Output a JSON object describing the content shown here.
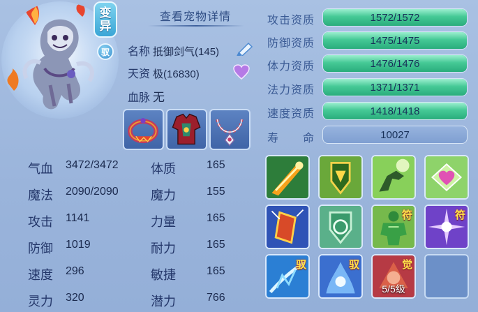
{
  "header": {
    "variant_badge": "变异",
    "variant_badge_top": "变",
    "variant_badge_bottom": "异",
    "tame_badge": "驭",
    "detail_title": "查看宠物详情"
  },
  "info": {
    "name_label": "名称",
    "name_value": "抵御剑气(145)",
    "talent_label": "天资",
    "talent_value": "极(16830)",
    "bloodline_label": "血脉",
    "bloodline_value": "无"
  },
  "equipment": [
    {
      "icon": "collar-icon"
    },
    {
      "icon": "armor-icon"
    },
    {
      "icon": "necklace-icon"
    }
  ],
  "stats": [
    {
      "label": "气血",
      "value": "3472/3472",
      "label2": "体质",
      "value2": "165"
    },
    {
      "label": "魔法",
      "value": "2090/2090",
      "label2": "魔力",
      "value2": "155"
    },
    {
      "label": "攻击",
      "value": "1141",
      "label2": "力量",
      "value2": "165"
    },
    {
      "label": "防御",
      "value": "1019",
      "label2": "耐力",
      "value2": "165"
    },
    {
      "label": "速度",
      "value": "296",
      "label2": "敏捷",
      "value2": "165"
    },
    {
      "label": "灵力",
      "value": "320",
      "label2": "潜力",
      "value2": "766"
    }
  ],
  "aptitudes": [
    {
      "label": "攻击资质",
      "text": "1572/1572",
      "current": 1572,
      "max": 1572
    },
    {
      "label": "防御资质",
      "text": "1475/1475",
      "current": 1475,
      "max": 1475
    },
    {
      "label": "体力资质",
      "text": "1476/1476",
      "current": 1476,
      "max": 1476
    },
    {
      "label": "法力资质",
      "text": "1371/1371",
      "current": 1371,
      "max": 1371
    },
    {
      "label": "速度资质",
      "text": "1418/1418",
      "current": 1418,
      "max": 1418
    }
  ],
  "life": {
    "label": "寿 命",
    "label_a": "寿",
    "label_b": "命",
    "value": "10027"
  },
  "skills": [
    {
      "icon": "sword-slash-icon",
      "tag": ""
    },
    {
      "icon": "shield-emblem-icon",
      "tag": ""
    },
    {
      "icon": "leaping-beast-icon",
      "tag": ""
    },
    {
      "icon": "heart-glow-icon",
      "tag": ""
    },
    {
      "icon": "burning-scroll-icon",
      "tag": ""
    },
    {
      "icon": "swirl-shield-icon",
      "tag": ""
    },
    {
      "icon": "green-brute-icon",
      "tag": "符"
    },
    {
      "icon": "purple-burst-icon",
      "tag": "符"
    },
    {
      "icon": "ice-strike-icon",
      "tag": "驭"
    },
    {
      "icon": "water-spirit-icon",
      "tag": "驭"
    },
    {
      "icon": "awaken-icon",
      "tag": "觉",
      "level": "5/5级"
    },
    {
      "icon": "empty-slot",
      "tag": ""
    }
  ],
  "colors": {
    "bar_fill": "#3cc28f",
    "panel": "#9cb6dc",
    "label": "#24376a"
  }
}
